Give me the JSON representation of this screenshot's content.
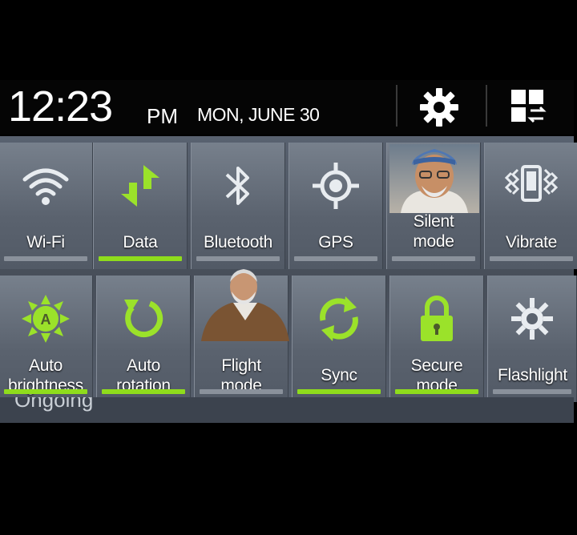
{
  "status": {
    "time": "12:23",
    "ampm": "PM",
    "date": "MON, JUNE 30"
  },
  "header_icons": [
    "gear-icon",
    "grid-switch-icon"
  ],
  "row1": [
    {
      "label": "Wi-Fi",
      "icon": "wifi-icon",
      "active": false
    },
    {
      "label": "Data",
      "icon": "data-arrows-icon",
      "active": true
    },
    {
      "label": "Bluetooth",
      "icon": "bluetooth-icon",
      "active": false
    },
    {
      "label": "GPS",
      "icon": "gps-icon",
      "active": false
    },
    {
      "label": "Silent\nmode",
      "icon": "portrait-icon",
      "active": false
    },
    {
      "label": "Vibrate",
      "icon": "vibrate-icon",
      "active": false
    }
  ],
  "row2": [
    {
      "label": "Auto\nbrightness",
      "icon": "brightness-icon",
      "active": true
    },
    {
      "label": "Auto\nrotation",
      "icon": "rotation-icon",
      "active": true
    },
    {
      "label": "Flight\nmode",
      "icon": "portrait-icon",
      "active": false
    },
    {
      "label": "Sync",
      "icon": "sync-icon",
      "active": true
    },
    {
      "label": "Secure\nmode",
      "icon": "lock-icon",
      "active": true
    },
    {
      "label": "Flashlight",
      "icon": "flashlight-icon",
      "active": false
    }
  ],
  "ongoing_label": "Ongoing",
  "colors": {
    "accent": "#8fdc1c",
    "panel": "#596270",
    "statusbar": "#050505"
  }
}
